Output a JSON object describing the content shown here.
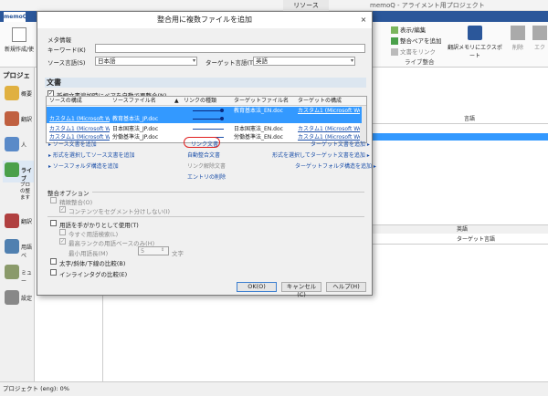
{
  "app": {
    "title": "memoQ - アライメント用プロジェクト",
    "context_tab": "リソース",
    "logo_tab": "memoQ",
    "status": "プロジェクト (eng): 0%"
  },
  "ribbon": {
    "new_project": "新規作成/使",
    "display_edit": "表示/編集",
    "add_pairs": "整合ペアを追加",
    "link_doc": "文書をリンク",
    "group_label": "ライブ整合",
    "export_label": "翻訳メモリにエクスポート",
    "delete_label": "削除",
    "ex_label": "エク"
  },
  "leftnav": {
    "header": "プロジェ",
    "items": [
      "概要",
      "翻訳",
      "人",
      "ライブ",
      "",
      "翻訳",
      "用語ベ",
      "ミュー",
      "設定"
    ],
    "live_desc": [
      "ブロ",
      "の整",
      "ます"
    ]
  },
  "rightpanel": {
    "col_lang": "言語",
    "sub_lang": "英語",
    "col_target": "ターゲット言語"
  },
  "dialog": {
    "title": "整合用に複数ファイルを追加",
    "close": "×",
    "meta_header": "メタ情報",
    "keyword_label": "キーワード(K)",
    "keyword_value": "",
    "source_lang_label": "ソース言語(S)",
    "source_lang_value": "日本語",
    "target_lang_label": "ターゲット言語(T)",
    "target_lang_value": "英語",
    "docs_section": "文書",
    "auto_realign_label": "新規文書追加時にペアを自動で再整合(N)",
    "columns": [
      "ソースの構成",
      "ソースファイル名",
      "リンクの種類",
      "ターゲットファイル名",
      "ターゲットの構成"
    ],
    "rows": [
      {
        "src_cfg": "",
        "src_file": "",
        "target_file": "教育基本法_EN.doc",
        "tgt_cfg": "カスタム1 (Microsoft Wor..."
      },
      {
        "src_cfg": "カスタム1 (Microsoft Wor...",
        "src_file": "教育基本法_JP.doc",
        "target_file": "",
        "tgt_cfg": ""
      },
      {
        "src_cfg": "カスタム1 (Microsoft Wor...",
        "src_file": "日本国憲法_JP.doc",
        "target_file": "日本国憲法_EN.doc",
        "tgt_cfg": "カスタム1 (Microsoft Wor..."
      },
      {
        "src_cfg": "カスタム1 (Microsoft Wor...",
        "src_file": "労働基準法_JP.doc",
        "target_file": "労働基準法_EN.doc",
        "tgt_cfg": "カスタム1 (Microsoft Wor..."
      }
    ],
    "actions": {
      "add_source": "ソース文書を追加",
      "add_source_fmt": "形式を選択してソース文書を追加",
      "add_source_folder": "ソースフォルダ構造を追加",
      "link_docs": "リンク文書",
      "auto_align": "自動整合文書",
      "unlink_docs": "リンク解除文書",
      "entry_delete": "エントリの削除",
      "add_target": "ターゲット文書を追加",
      "add_target_fmt": "形式を選択してターゲット文書を追加",
      "add_target_folder": "ターゲットフォルダ構造を追加"
    },
    "align_options": "整合オプション",
    "opt_precise": "精緻整合(O)",
    "opt_content_no_seg": "コンテンツをセグメント分けしない(I)",
    "opt_use_term": "用語を手がかりとして使用(T)",
    "opt_search_term": "今すぐ用語検索(L)",
    "opt_use_only": "最高ランクの用語ベースのみ(H)",
    "min_term_len_label": "最小用語長(M)",
    "min_term_len_value": "5",
    "min_term_unit": "文字",
    "opt_bold": "太字/斜体/下線の比較(B)",
    "opt_inline": "インラインタグの比較(E)",
    "ok": "OK(O)",
    "cancel": "キャンセル(C)",
    "help": "ヘルプ(H)"
  },
  "colors": {
    "accent": "#2b579a",
    "selection": "#3399ff",
    "link": "#1a4ea8",
    "highlight_circle": "#e02020"
  }
}
